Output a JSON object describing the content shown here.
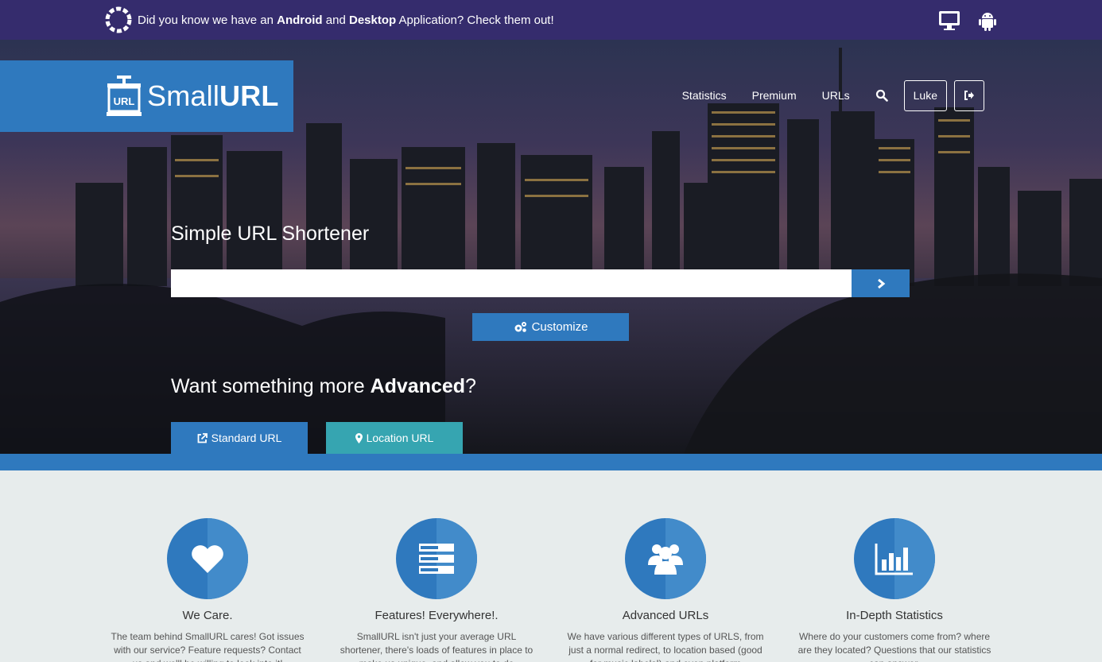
{
  "banner": {
    "prefix": "Did you know we have an ",
    "android": "Android",
    "and": " and ",
    "desktop": "Desktop",
    "suffix": " Application? Check them out!"
  },
  "logo": {
    "small": "Small",
    "url": "URL",
    "badge": "URL"
  },
  "nav": {
    "statistics": "Statistics",
    "premium": "Premium",
    "urls": "URLs",
    "user": "Luke"
  },
  "hero": {
    "title": "Simple URL Shortener",
    "input_value": "",
    "customize": "Customize",
    "advanced_prefix": "Want something more ",
    "advanced_bold": "Advanced",
    "advanced_suffix": "?",
    "standard_url": "Standard URL",
    "location_url": "Location URL"
  },
  "features": [
    {
      "title": "We Care.",
      "text": "The team behind SmallURL cares! Got issues with our service? Feature requests? Contact us and we'll be willing to look into it!",
      "icon": "heart-icon"
    },
    {
      "title": "Features! Everywhere!.",
      "text": "SmallURL isn't just your average URL shortener, there's loads of features in place to make us unique, and allow you to do",
      "icon": "server-icon"
    },
    {
      "title": "Advanced URLs",
      "text": "We have various different types of URLS, from just a normal redirect, to location based (good for music labels!) and even platform",
      "icon": "users-icon"
    },
    {
      "title": "In-Depth Statistics",
      "text": "Where do your customers come from? where are they located? Questions that our statistics can answer.",
      "icon": "bar-chart-icon"
    }
  ],
  "colors": {
    "banner": "#352c6d",
    "primary": "#2f79be",
    "teal": "#36a5b1",
    "page_bg": "#e7ecec"
  }
}
